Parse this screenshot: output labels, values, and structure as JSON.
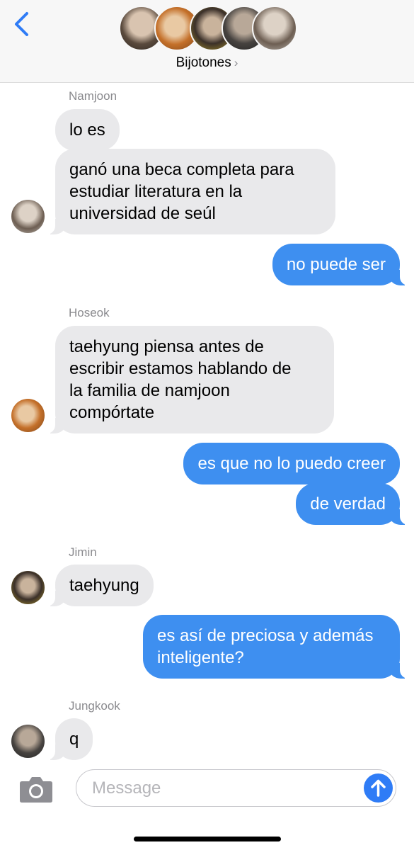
{
  "header": {
    "group_name": "Bijotones",
    "chevron": "›",
    "member_avatars": [
      "avatar-1",
      "avatar-2",
      "avatar-3",
      "avatar-4",
      "avatar-5"
    ]
  },
  "messages": [
    {
      "sender": "Namjoon",
      "direction": "incoming",
      "texts": [
        "lo es",
        "ganó una beca completa para",
        "estudiar literatura en la",
        "universidad de seúl"
      ]
    },
    {
      "direction": "outgoing",
      "text": "no puede ser"
    },
    {
      "sender": "Hoseok",
      "direction": "incoming",
      "lines": [
        "taehyung piensa antes de",
        "escribir estamos hablando de",
        "la familia de namjoon",
        "compórtate"
      ]
    },
    {
      "direction": "outgoing",
      "text": "es que no lo puedo creer"
    },
    {
      "direction": "outgoing",
      "text": "de verdad"
    },
    {
      "sender": "Jimin",
      "direction": "incoming",
      "text": "taehyung"
    },
    {
      "direction": "outgoing",
      "lines": [
        "es así de preciosa y además",
        "inteligente?"
      ]
    },
    {
      "sender": "Jungkook",
      "direction": "incoming",
      "text": "q"
    }
  ],
  "composer": {
    "placeholder": "Message",
    "camera_icon": "camera-icon",
    "send_icon": "arrow-up-icon"
  },
  "colors": {
    "incoming_bubble": "#e9e9eb",
    "outgoing_bubble": "#3e8ff0",
    "accent": "#2f7cf6"
  }
}
